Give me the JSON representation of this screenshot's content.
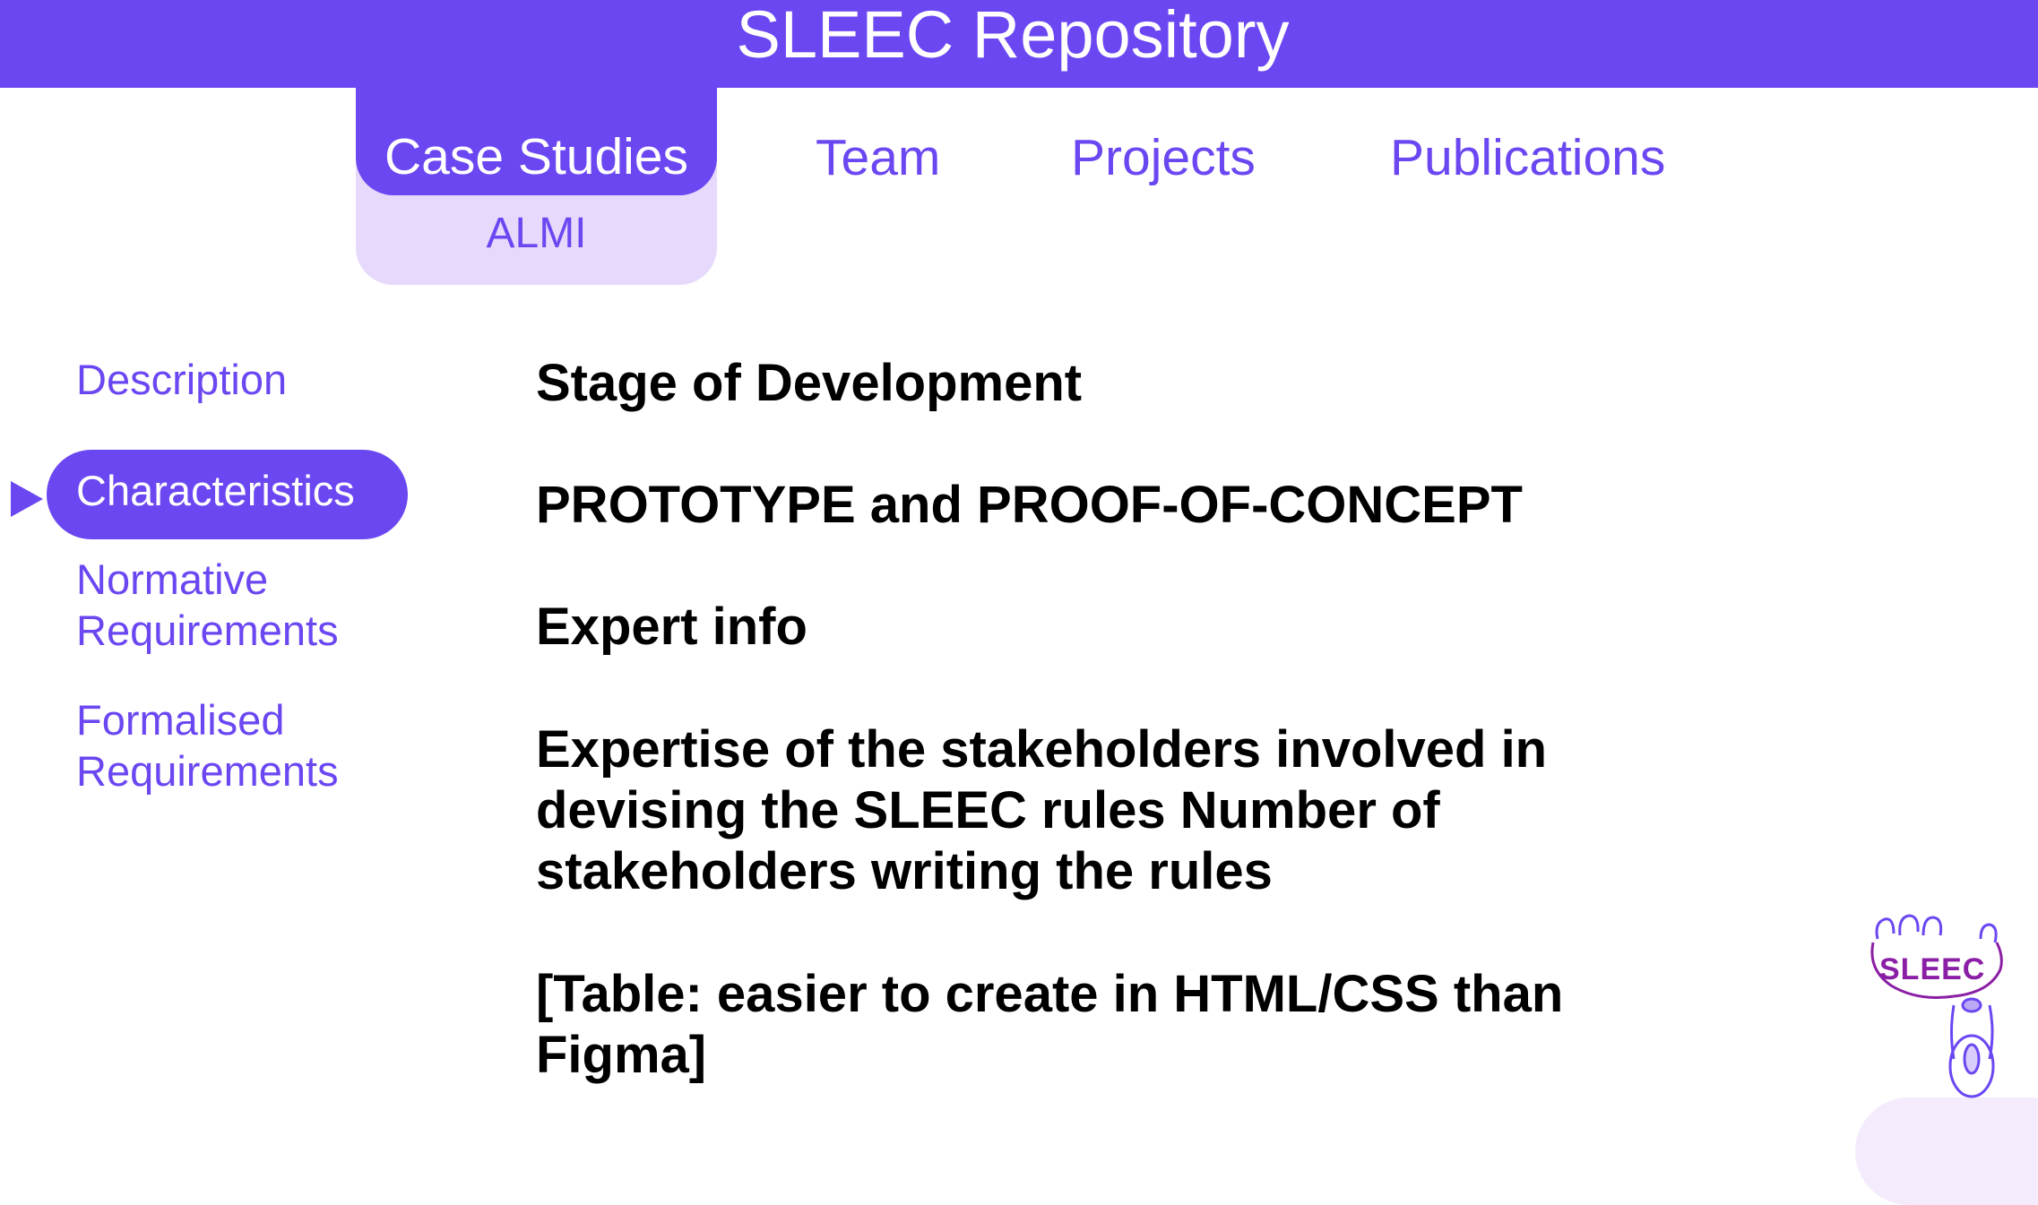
{
  "header": {
    "title": "SLEEC Repository"
  },
  "nav": {
    "case_studies": "Case Studies",
    "case_studies_sub": "ALMI",
    "team": "Team",
    "projects": "Projects",
    "publications": "Publications"
  },
  "sidebar": {
    "items": [
      {
        "label": "Description"
      },
      {
        "label": "Characteristics",
        "active": true
      },
      {
        "label_lines": [
          "Normative",
          "Requirements"
        ]
      },
      {
        "label_lines": [
          "Formalised",
          "Requirements"
        ]
      }
    ]
  },
  "main": {
    "stage_heading": "Stage of Development",
    "stage_value": "PROTOTYPE and PROOF-OF-CONCEPT",
    "expert_heading": "Expert info",
    "expert_lines": [
      "Expertise of the stakeholders involved in",
      "devising the SLEEC rules Number of",
      "stakeholders writing the rules"
    ],
    "table_lines": [
      "[Table: easier to create in HTML/CSS than",
      "Figma]"
    ]
  },
  "logo": {
    "text": "SLEEC",
    "color": "#8a1fa5"
  },
  "colors": {
    "accent": "#6b47f2",
    "accent_light": "#e7d9fb",
    "text": "#000000"
  }
}
